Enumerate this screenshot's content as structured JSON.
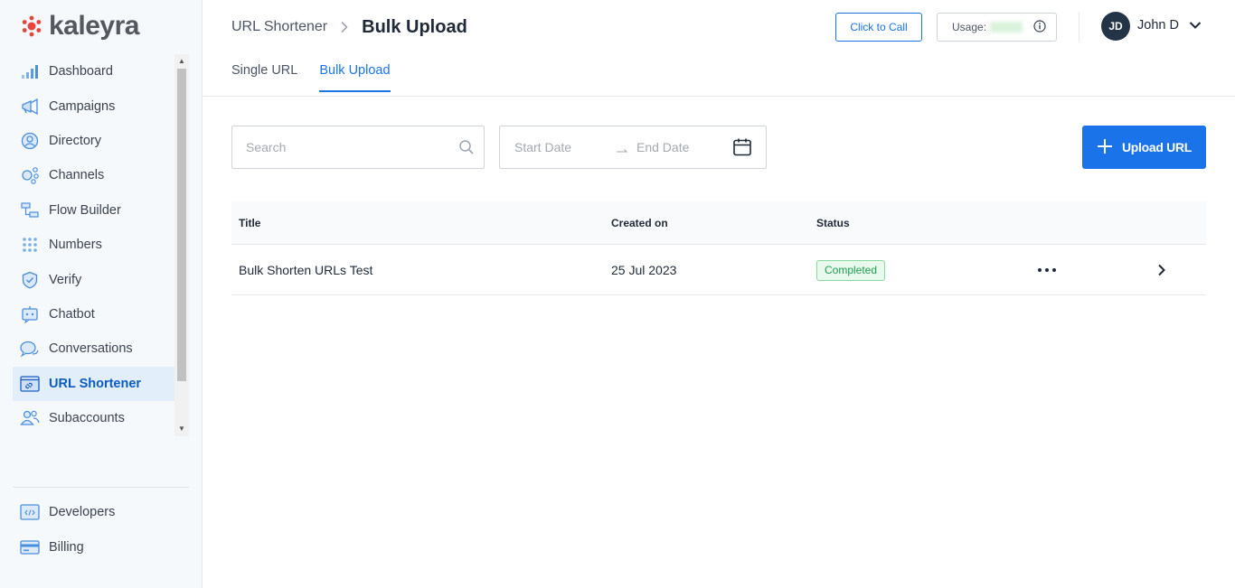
{
  "brand": {
    "name": "kaleyra",
    "logo_color": "#e8423c"
  },
  "sidebar": {
    "items": [
      {
        "label": "Dashboard",
        "icon": "bar-chart-icon"
      },
      {
        "label": "Campaigns",
        "icon": "megaphone-icon"
      },
      {
        "label": "Directory",
        "icon": "user-circle-icon"
      },
      {
        "label": "Channels",
        "icon": "channels-icon"
      },
      {
        "label": "Flow Builder",
        "icon": "flow-icon"
      },
      {
        "label": "Numbers",
        "icon": "dial-pad-icon"
      },
      {
        "label": "Verify",
        "icon": "shield-check-icon"
      },
      {
        "label": "Chatbot",
        "icon": "chatbot-icon"
      },
      {
        "label": "Conversations",
        "icon": "chat-bubbles-icon"
      },
      {
        "label": "URL Shortener",
        "icon": "link-icon",
        "active": true
      },
      {
        "label": "Subaccounts",
        "icon": "users-icon"
      }
    ],
    "bottom_items": [
      {
        "label": "Developers",
        "icon": "code-icon"
      },
      {
        "label": "Billing",
        "icon": "card-icon"
      }
    ]
  },
  "header": {
    "breadcrumb_parent": "URL Shortener",
    "breadcrumb_current": "Bulk Upload",
    "click_to_call": "Click to Call",
    "usage_label": "Usage:",
    "user_initials": "JD",
    "user_name": "John D"
  },
  "tabs": [
    {
      "label": "Single URL",
      "active": false
    },
    {
      "label": "Bulk Upload",
      "active": true
    }
  ],
  "filters": {
    "search_placeholder": "Search",
    "start_date_placeholder": "Start Date",
    "end_date_placeholder": "End Date",
    "upload_label": "Upload URL"
  },
  "table": {
    "columns": [
      "Title",
      "Created on",
      "Status"
    ],
    "rows": [
      {
        "title": "Bulk Shorten URLs Test",
        "created_on": "25 Jul 2023",
        "status": "Completed"
      }
    ]
  },
  "colors": {
    "accent": "#1a73e8",
    "active_bg": "#e3eefb",
    "status_completed": "#1b9e4b",
    "avatar_bg": "#243447"
  }
}
